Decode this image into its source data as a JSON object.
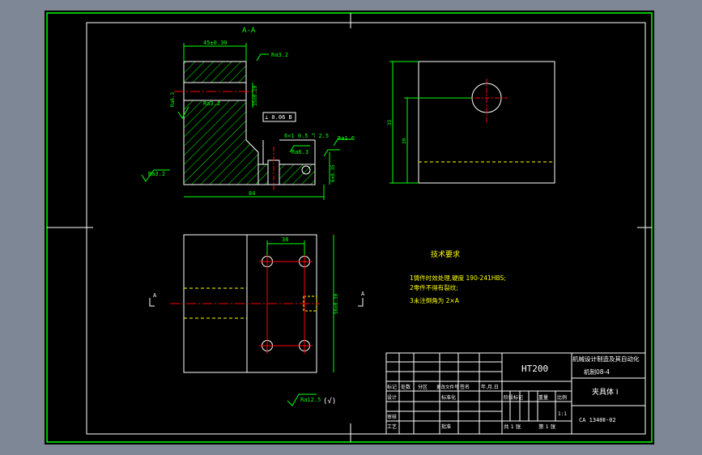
{
  "colors": {
    "background": "#7d8795",
    "sheet": "#000000",
    "border": "#00ff00",
    "outline": "#ffffff",
    "dimension": "#00ff00",
    "annotation": "#ffff00",
    "centerline": "#ff0000",
    "hatch": "#00ff00"
  },
  "section_label": "A-A",
  "views": {
    "section": {
      "top_width": "45±0.30",
      "height_dim": "35±0.10",
      "base_width": "84",
      "slot_label": "6×1 0.5 ℸ 2.5",
      "right_height": "6±0.35",
      "datum_ref": "⊥ 0.06 B",
      "ra_values": [
        "Ra3.2",
        "Ra3.2",
        "Ra6.3",
        "Ra3.2",
        "Ra6.3",
        "Ra1.6"
      ]
    },
    "side": {
      "dim_outer": "35",
      "dim_inner": "30"
    },
    "plan": {
      "hole_spacing": "38",
      "side_height": "56±0.30",
      "cut_mark_left": "A",
      "cut_mark_right": "A"
    }
  },
  "tech_requirements": {
    "title": "技术要求",
    "items": [
      "1铸件时效处理,硬度 190-241HBS;",
      "2零件不得有裂纹;",
      "3未注倒角为 2×A"
    ]
  },
  "roughness_note": {
    "symbol": "Ra12.5",
    "suffix": "(√)"
  },
  "title_block": {
    "material": "HT200",
    "org_line1": "机械设计制造及其自动化",
    "org_line2": "机制08-4",
    "part_name": "夹具体 I",
    "drawing_no": "CA 1340Ⅱ-02",
    "scale": "1:1",
    "sheets": "共 1 张",
    "sheet_no": "第 1 张",
    "labels": {
      "mark": "标记",
      "count": "处数",
      "zone": "分区",
      "change_doc": "更改文件号",
      "signature": "签名",
      "date": "年.月.日",
      "design": "设计",
      "standardize": "标准化",
      "stage_mark": "阶段标记",
      "weight": "重量",
      "ratio": "比例",
      "review": "审核",
      "process": "工艺",
      "approve": "批准"
    }
  }
}
